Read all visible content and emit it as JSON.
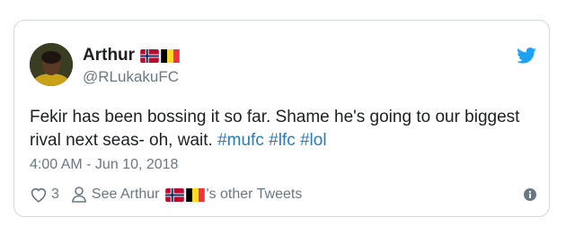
{
  "tweet": {
    "author": {
      "display_name": "Arthur",
      "handle": "@RLukakuFC",
      "flags": [
        "norway-flag-icon",
        "belgium-flag-icon"
      ]
    },
    "text_parts": {
      "line": "Fekir has been bossing it so far. Shame he's going to our biggest rival next seas- oh, wait.",
      "hashtags": [
        "#mufc",
        "#lfc",
        "#lol"
      ]
    },
    "timestamp": "4:00 AM - Jun 10, 2018",
    "like_count": "3",
    "see_other_prefix": "See Arthur",
    "see_other_suffix": "'s other Tweets"
  },
  "colors": {
    "link": "#2b7bb9",
    "secondary_text": "#697882",
    "twitter_blue": "#1da1f2",
    "border": "#cfd9de"
  },
  "icons": [
    "twitter-bird-icon",
    "heart-icon",
    "person-icon",
    "info-icon"
  ]
}
